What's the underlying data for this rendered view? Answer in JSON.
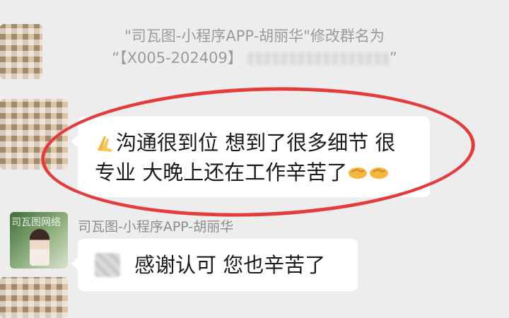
{
  "system_message": {
    "line1": "\"司瓦图-小程序APP-胡丽华\"修改群名为",
    "line2_prefix": "“【X005-202409】",
    "line2_suffix": "”"
  },
  "messages": [
    {
      "sender": "",
      "line1": "沟通很到位 想到了很多细节 很",
      "line2": "专业 大晚上还在工作辛苦了",
      "leading_icon": "praying-hands-icon",
      "trailing_icons": [
        "handshake-icon",
        "handshake-icon"
      ]
    },
    {
      "sender": "司瓦图-小程序APP-胡丽华",
      "text": "感谢认可 您也辛苦了",
      "avatar_caption": "司瓦图网络"
    }
  ],
  "highlight_color": "#e53b3b"
}
